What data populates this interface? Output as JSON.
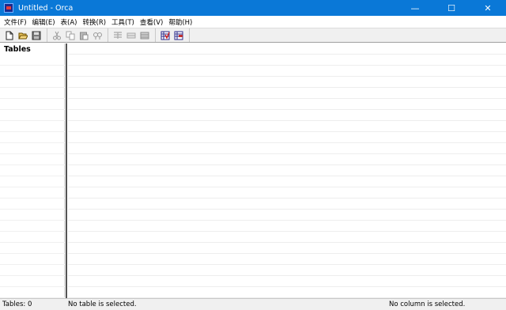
{
  "window": {
    "title": "Untitled - Orca",
    "controls": {
      "minimize": "—",
      "maximize": "☐",
      "close": "✕"
    }
  },
  "menu": {
    "items": [
      "文件(F)",
      "编辑(E)",
      "表(A)",
      "转换(R)",
      "工具(T)",
      "查看(V)",
      "帮助(H)"
    ]
  },
  "toolbar": {
    "groups": [
      [
        "new-icon",
        "open-icon",
        "save-icon"
      ],
      [
        "cut-icon",
        "copy-icon",
        "paste-icon",
        "find-icon"
      ],
      [
        "add-table-icon",
        "drop-table-icon",
        "add-row-icon"
      ],
      [
        "validate-icon",
        "transform-icon"
      ]
    ]
  },
  "left_pane": {
    "header": "Tables"
  },
  "status": {
    "tables": "Tables: 0",
    "table": "No table is selected.",
    "column": "No column is selected."
  },
  "colors": {
    "titlebar": "#0a78d7",
    "toolbar_bg": "#f0f0f0",
    "grid_line": "#ededed"
  }
}
